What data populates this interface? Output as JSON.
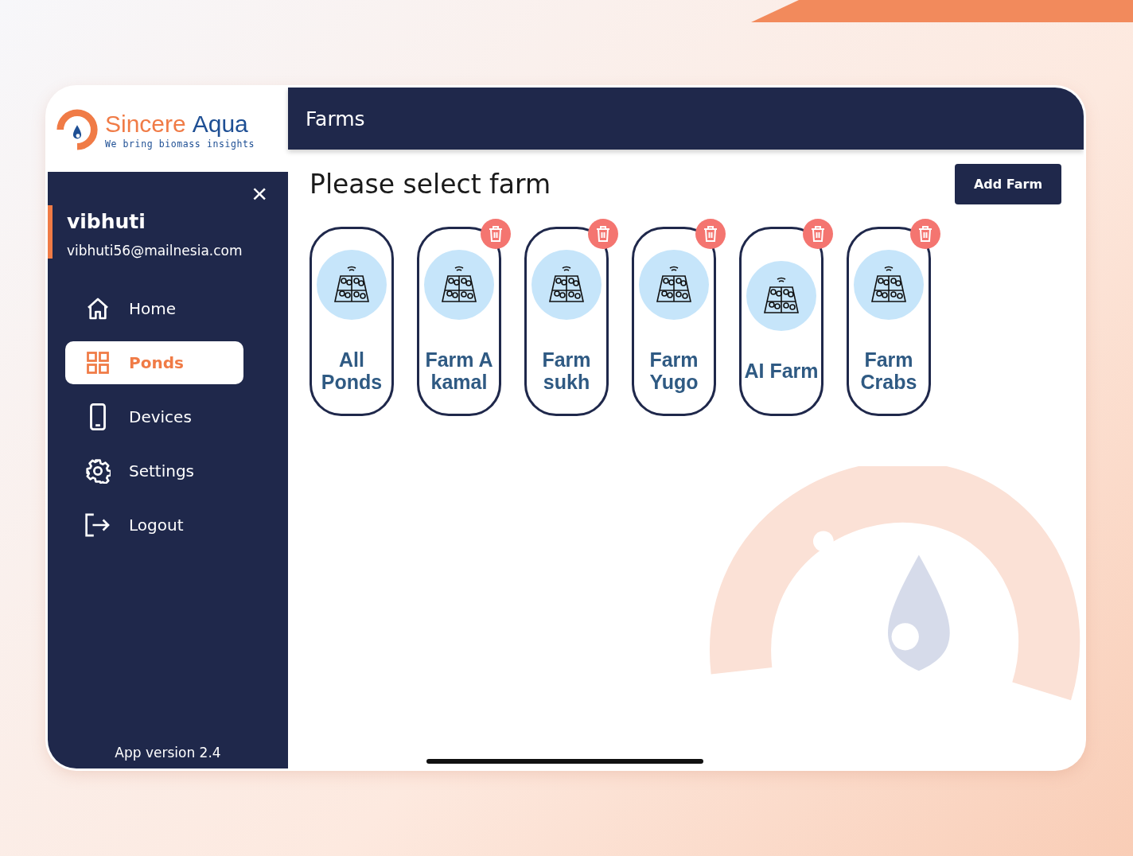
{
  "brand": {
    "name_part_1": "Sincere",
    "name_part_2": "Aqua",
    "tagline": "We bring biomass insights"
  },
  "user": {
    "name": "vibhuti",
    "email": "vibhuti56@mailnesia.com"
  },
  "close_icon": "×",
  "nav": [
    {
      "kind": "home",
      "label": "Home",
      "selected": false
    },
    {
      "kind": "ponds",
      "label": "Ponds",
      "selected": true
    },
    {
      "kind": "devices",
      "label": "Devices",
      "selected": false
    },
    {
      "kind": "settings",
      "label": "Settings",
      "selected": false
    },
    {
      "kind": "logout",
      "label": "Logout",
      "selected": false
    }
  ],
  "app_version": "App version 2.4",
  "header": {
    "title": "Farms"
  },
  "heading": "Please select farm",
  "add_button": "Add Farm",
  "farms": [
    {
      "label": "All Ponds",
      "deletable": false
    },
    {
      "label": "Farm A kamal",
      "deletable": true
    },
    {
      "label": "Farm sukh",
      "deletable": true
    },
    {
      "label": "Farm Yugo",
      "deletable": true
    },
    {
      "label": "AI Farm",
      "deletable": true
    },
    {
      "label": "Farm Crabs",
      "deletable": true
    }
  ]
}
